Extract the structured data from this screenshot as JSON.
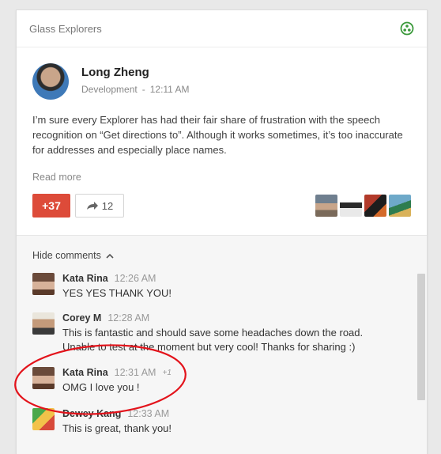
{
  "community": {
    "name": "Glass Explorers",
    "icon": "community-icon",
    "accent": "#3c9a3c"
  },
  "post": {
    "author": "Long Zheng",
    "category": "Development",
    "time": "12:11 AM",
    "text": "I’m sure every Explorer has had their fair share of frustration with the speech recognition on “Get directions to”. Although it works sometimes, it’s too inaccurate for addresses and especially place names.",
    "read_more": "Read more",
    "plus_count": "+37",
    "share_count": "12"
  },
  "comments_toggle": "Hide comments",
  "comments": [
    {
      "name": "Kata Rina",
      "time": "12:26 AM",
      "plus": "",
      "text": "YES YES THANK YOU!"
    },
    {
      "name": "Corey M",
      "time": "12:28 AM",
      "plus": "",
      "text": "This is fantastic and should save some headaches down the road. Unable to test at the moment but very cool! Thanks for sharing :)"
    },
    {
      "name": "Kata Rina",
      "time": "12:31 AM",
      "plus": "+1",
      "text": "OMG I love you !"
    },
    {
      "name": "Dewey Kang",
      "time": "12:33 AM",
      "plus": "",
      "text": "This is great, thank you!"
    }
  ],
  "colors": {
    "plus_button": "#dd4b39",
    "annotation": "#e3131b"
  }
}
